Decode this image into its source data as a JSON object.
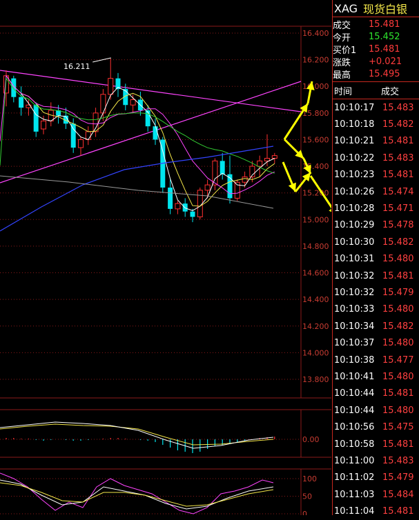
{
  "instrument": {
    "symbol": "XAG",
    "name": "现货白银"
  },
  "quote": [
    {
      "label": "成交",
      "value": "15.481",
      "color": "#ff3b3b"
    },
    {
      "label": "今开",
      "value": "15.452",
      "color": "#2ee52e"
    },
    {
      "label": "买价1",
      "value": "15.481",
      "color": "#ff3b3b"
    },
    {
      "label": "涨跌",
      "value": "+0.021",
      "color": "#ff3b3b"
    },
    {
      "label": "最高",
      "value": "15.495",
      "color": "#ff3b3b"
    }
  ],
  "ticks_header": {
    "time": "时间",
    "price": "成交"
  },
  "ticks": [
    {
      "time": "10:10:17",
      "price": "15.483"
    },
    {
      "time": "10:10:18",
      "price": "15.482"
    },
    {
      "time": "10:10:21",
      "price": "15.481"
    },
    {
      "time": "10:10:22",
      "price": "15.483"
    },
    {
      "time": "10:10:23",
      "price": "15.481"
    },
    {
      "time": "10:10:26",
      "price": "15.474"
    },
    {
      "time": "10:10:28",
      "price": "15.471"
    },
    {
      "time": "10:10:29",
      "price": "15.478"
    },
    {
      "time": "10:10:30",
      "price": "15.482"
    },
    {
      "time": "10:10:31",
      "price": "15.480"
    },
    {
      "time": "10:10:32",
      "price": "15.481"
    },
    {
      "time": "10:10:32",
      "price": "15.479"
    },
    {
      "time": "10:10:33",
      "price": "15.480"
    },
    {
      "time": "10:10:34",
      "price": "15.482"
    },
    {
      "time": "10:10:37",
      "price": "15.480"
    },
    {
      "time": "10:10:38",
      "price": "15.477"
    },
    {
      "time": "10:10:41",
      "price": "15.480"
    },
    {
      "time": "10:10:44",
      "price": "15.481"
    },
    {
      "time": "10:10:44",
      "price": "15.480"
    },
    {
      "time": "10:10:56",
      "price": "15.475"
    },
    {
      "time": "10:10:58",
      "price": "15.481"
    },
    {
      "time": "10:11:00",
      "price": "15.483"
    },
    {
      "time": "10:11:02",
      "price": "15.479"
    },
    {
      "time": "10:11:03",
      "price": "15.484"
    },
    {
      "time": "10:11:04",
      "price": "15.481"
    }
  ],
  "price_axis": {
    "labels": [
      "16.400",
      "16.200",
      "16.000",
      "15.800",
      "15.600",
      "15.400",
      "15.200",
      "15.000",
      "14.800",
      "14.600",
      "14.400",
      "14.200",
      "14.000",
      "13.800"
    ],
    "min": 13.8,
    "max": 16.4,
    "high_annotation": "16.211"
  },
  "macd_axis": {
    "labels": [
      "0.00"
    ]
  },
  "kdj_axis": {
    "labels": [
      "100",
      "50",
      "0"
    ]
  },
  "colors": {
    "up_candle": "#ff3030",
    "down_candle": "#00e5ee",
    "grid": "#8b1a1a",
    "axis_text": "#c83c32",
    "ma_white": "#ffffff",
    "ma_yellow": "#f5e84a",
    "ma_magenta": "#ff44ff",
    "ma_green": "#33cc33",
    "ma_blue": "#3344ff",
    "ma_gray": "#999999",
    "trendline": "#ff44ff",
    "arrow": "#ffff00"
  },
  "candles": [
    {
      "o": 15.95,
      "h": 16.12,
      "l": 15.85,
      "c": 16.08
    },
    {
      "o": 16.06,
      "h": 16.08,
      "l": 15.88,
      "c": 15.92
    },
    {
      "o": 15.92,
      "h": 16.0,
      "l": 15.78,
      "c": 15.84
    },
    {
      "o": 15.84,
      "h": 15.9,
      "l": 15.78,
      "c": 15.86
    },
    {
      "o": 15.86,
      "h": 15.88,
      "l": 15.62,
      "c": 15.66
    },
    {
      "o": 15.68,
      "h": 15.78,
      "l": 15.64,
      "c": 15.74
    },
    {
      "o": 15.74,
      "h": 15.88,
      "l": 15.7,
      "c": 15.82
    },
    {
      "o": 15.82,
      "h": 15.86,
      "l": 15.72,
      "c": 15.78
    },
    {
      "o": 15.78,
      "h": 15.84,
      "l": 15.68,
      "c": 15.72
    },
    {
      "o": 15.72,
      "h": 15.76,
      "l": 15.5,
      "c": 15.54
    },
    {
      "o": 15.54,
      "h": 15.62,
      "l": 15.48,
      "c": 15.6
    },
    {
      "o": 15.6,
      "h": 15.7,
      "l": 15.56,
      "c": 15.66
    },
    {
      "o": 15.66,
      "h": 15.84,
      "l": 15.62,
      "c": 15.8
    },
    {
      "o": 15.8,
      "h": 15.98,
      "l": 15.74,
      "c": 15.94
    },
    {
      "o": 15.94,
      "h": 16.21,
      "l": 15.9,
      "c": 16.06
    },
    {
      "o": 16.06,
      "h": 16.1,
      "l": 15.92,
      "c": 15.98
    },
    {
      "o": 15.98,
      "h": 16.02,
      "l": 15.82,
      "c": 15.86
    },
    {
      "o": 15.86,
      "h": 15.94,
      "l": 15.8,
      "c": 15.9
    },
    {
      "o": 15.9,
      "h": 15.96,
      "l": 15.78,
      "c": 15.82
    },
    {
      "o": 15.82,
      "h": 15.86,
      "l": 15.66,
      "c": 15.7
    },
    {
      "o": 15.7,
      "h": 15.76,
      "l": 15.56,
      "c": 15.6
    },
    {
      "o": 15.6,
      "h": 15.62,
      "l": 15.2,
      "c": 15.24
    },
    {
      "o": 15.24,
      "h": 15.3,
      "l": 15.04,
      "c": 15.08
    },
    {
      "o": 15.08,
      "h": 15.14,
      "l": 15.04,
      "c": 15.12
    },
    {
      "o": 15.12,
      "h": 15.16,
      "l": 15.02,
      "c": 15.06
    },
    {
      "o": 15.06,
      "h": 15.08,
      "l": 14.98,
      "c": 15.02
    },
    {
      "o": 15.02,
      "h": 15.24,
      "l": 15.0,
      "c": 15.22
    },
    {
      "o": 15.22,
      "h": 15.3,
      "l": 15.16,
      "c": 15.26
    },
    {
      "o": 15.26,
      "h": 15.46,
      "l": 15.22,
      "c": 15.44
    },
    {
      "o": 15.44,
      "h": 15.5,
      "l": 15.3,
      "c": 15.34
    },
    {
      "o": 15.34,
      "h": 15.48,
      "l": 15.12,
      "c": 15.16
    },
    {
      "o": 15.16,
      "h": 15.3,
      "l": 15.14,
      "c": 15.28
    },
    {
      "o": 15.28,
      "h": 15.36,
      "l": 15.24,
      "c": 15.32
    },
    {
      "o": 15.32,
      "h": 15.44,
      "l": 15.28,
      "c": 15.4
    },
    {
      "o": 15.4,
      "h": 15.48,
      "l": 15.32,
      "c": 15.44
    },
    {
      "o": 15.44,
      "h": 15.64,
      "l": 15.4,
      "c": 15.46
    },
    {
      "o": 15.46,
      "h": 15.5,
      "l": 15.42,
      "c": 15.48
    }
  ]
}
